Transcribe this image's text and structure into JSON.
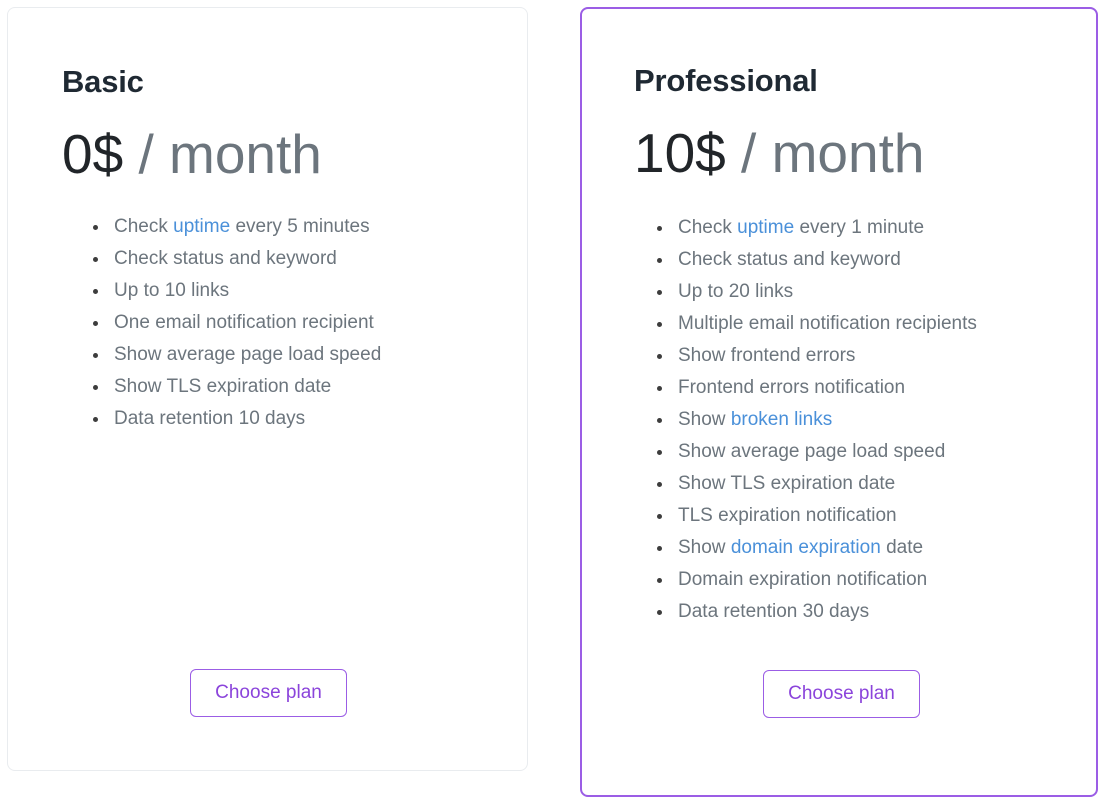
{
  "theme": {
    "accent_purple": "#9b5de5",
    "button_text_purple": "#8b44db",
    "link_blue": "#4a90d9",
    "muted_text": "#6c757d",
    "heading_text": "#1f2933",
    "card_border_gray": "#e9ecef",
    "page_background": "#ffffff"
  },
  "plans": [
    {
      "id": "basic",
      "name": "Basic",
      "price_amount": "0$",
      "price_period": "/ month",
      "highlighted": false,
      "features": [
        {
          "prefix": "Check ",
          "link": "uptime",
          "suffix": " every 5 minutes"
        },
        {
          "prefix": "Check status and keyword",
          "link": "",
          "suffix": ""
        },
        {
          "prefix": "Up to 10 links",
          "link": "",
          "suffix": ""
        },
        {
          "prefix": "One email notification recipient",
          "link": "",
          "suffix": ""
        },
        {
          "prefix": "Show average page load speed",
          "link": "",
          "suffix": ""
        },
        {
          "prefix": "Show TLS expiration date",
          "link": "",
          "suffix": ""
        },
        {
          "prefix": "Data retention 10 days",
          "link": "",
          "suffix": ""
        }
      ],
      "cta_label": "Choose plan"
    },
    {
      "id": "professional",
      "name": "Professional",
      "price_amount": "10$",
      "price_period": "/ month",
      "highlighted": true,
      "features": [
        {
          "prefix": "Check ",
          "link": "uptime",
          "suffix": " every 1 minute"
        },
        {
          "prefix": "Check status and keyword",
          "link": "",
          "suffix": ""
        },
        {
          "prefix": "Up to 20 links",
          "link": "",
          "suffix": ""
        },
        {
          "prefix": "Multiple email notification recipients",
          "link": "",
          "suffix": ""
        },
        {
          "prefix": "Show frontend errors",
          "link": "",
          "suffix": ""
        },
        {
          "prefix": "Frontend errors notification",
          "link": "",
          "suffix": ""
        },
        {
          "prefix": "Show ",
          "link": "broken links",
          "suffix": ""
        },
        {
          "prefix": "Show average page load speed",
          "link": "",
          "suffix": ""
        },
        {
          "prefix": "Show TLS expiration date",
          "link": "",
          "suffix": ""
        },
        {
          "prefix": "TLS expiration notification",
          "link": "",
          "suffix": ""
        },
        {
          "prefix": "Show ",
          "link": "domain expiration",
          "suffix": " date"
        },
        {
          "prefix": "Domain expiration notification",
          "link": "",
          "suffix": ""
        },
        {
          "prefix": "Data retention 30 days",
          "link": "",
          "suffix": ""
        }
      ],
      "cta_label": "Choose plan"
    }
  ]
}
